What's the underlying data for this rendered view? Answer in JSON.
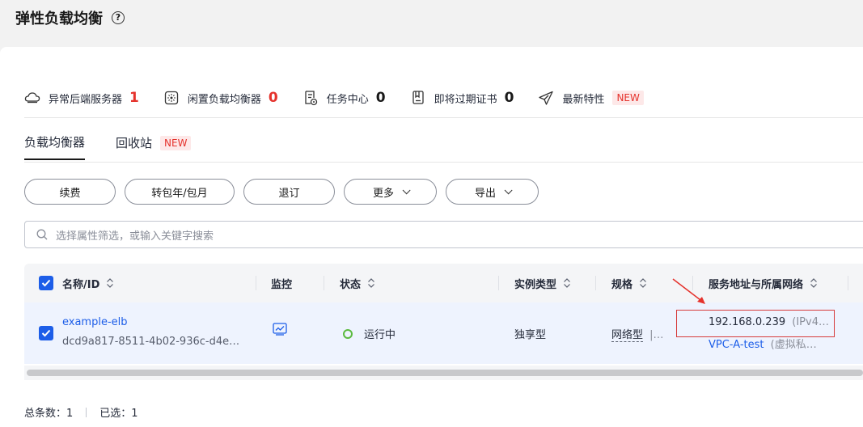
{
  "page": {
    "title": "弹性负载均衡",
    "help_icon": "?"
  },
  "stats": [
    {
      "icon": "cloud-server-icon",
      "label": "异常后端服务器",
      "count": "1",
      "count_color": "#e5322c"
    },
    {
      "icon": "idle-lb-icon",
      "label": "闲置负载均衡器",
      "count": "0",
      "count_color": "#e5322c"
    },
    {
      "icon": "task-icon",
      "label": "任务中心",
      "count": "0",
      "count_color": "#191919"
    },
    {
      "icon": "certificate-icon",
      "label": "即将过期证书",
      "count": "0",
      "count_color": "#191919"
    },
    {
      "icon": "send-icon",
      "label": "最新特性",
      "badge": "NEW"
    }
  ],
  "tabs": [
    {
      "label": "负载均衡器",
      "active": true
    },
    {
      "label": "回收站",
      "badge": "NEW",
      "active": false
    }
  ],
  "toolbar": {
    "renew": "续费",
    "to_yearly": "转包年/包月",
    "unsubscribe": "退订",
    "more": "更多",
    "export": "导出"
  },
  "search": {
    "placeholder": "选择属性筛选，或输入关键字搜索"
  },
  "table": {
    "columns": {
      "name": "名称/ID",
      "monitor": "监控",
      "status": "状态",
      "instance_type": "实例类型",
      "spec": "规格",
      "address": "服务地址与所属网络"
    },
    "rows": [
      {
        "checked": true,
        "name": "example-elb",
        "id": "dcd9a817-8511-4b02-936c-d4e…",
        "status": "运行中",
        "status_color": "#5bba3f",
        "instance_type": "独享型",
        "spec": "网络型",
        "spec_more": "|…",
        "ip": "192.168.0.239",
        "ip_type": "(IPv4…",
        "vpc": "VPC-A-test",
        "vpc_type": "(虚拟私…"
      }
    ]
  },
  "footer": {
    "total": "总条数：1",
    "selected": "已选：1"
  },
  "colors": {
    "accent": "#1d5ee8",
    "danger": "#e5322c",
    "success": "#5bba3f"
  }
}
